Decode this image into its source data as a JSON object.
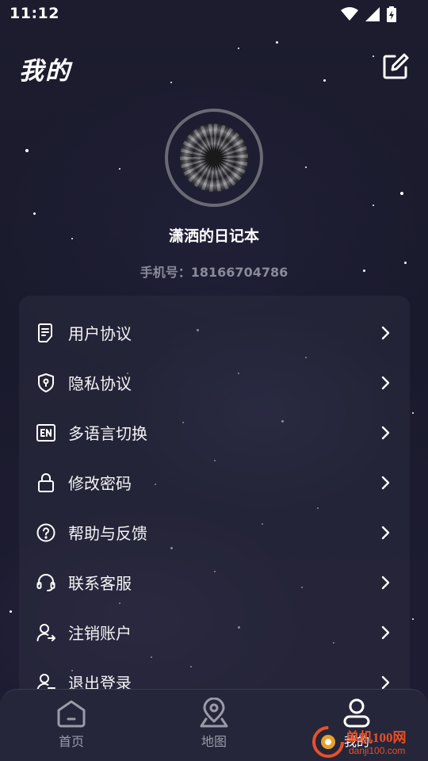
{
  "status_bar": {
    "time": "11:12"
  },
  "header": {
    "title": "我的"
  },
  "profile": {
    "name": "潇洒的日记本",
    "phone": "手机号：18166704786"
  },
  "menu": [
    {
      "label": "用户协议",
      "icon": "document-icon"
    },
    {
      "label": "隐私协议",
      "icon": "shield-icon"
    },
    {
      "label": "多语言切换",
      "icon": "language-en-icon"
    },
    {
      "label": "修改密码",
      "icon": "lock-icon"
    },
    {
      "label": "帮助与反馈",
      "icon": "help-icon"
    },
    {
      "label": "联系客服",
      "icon": "headset-icon"
    },
    {
      "label": "注销账户",
      "icon": "user-remove-icon"
    },
    {
      "label": "退出登录",
      "icon": "logout-icon"
    }
  ],
  "nav": {
    "home": "首页",
    "map": "地图",
    "mine": "我的"
  },
  "watermark": {
    "text": "单机100网",
    "url": "danji100.com"
  },
  "colors": {
    "background": "#1b1a2e",
    "card": "#2c2c40",
    "muted_text": "#8a8a99",
    "nav_bg": "#26263a"
  }
}
